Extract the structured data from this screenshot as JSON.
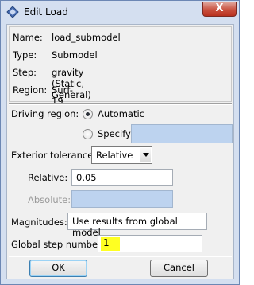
{
  "window": {
    "title": "Edit Load",
    "close_glyph": "X",
    "app_icon": "blue-diamond-icon"
  },
  "info": {
    "name_label": "Name:",
    "name_value": "load_submodel",
    "type_label": "Type:",
    "type_value": "Submodel",
    "step_label": "Step:",
    "step_value": "gravity (Static, General)",
    "region_label": "Region:",
    "region_value": "Surf-19"
  },
  "driving_region": {
    "label": "Driving region:",
    "options": [
      {
        "label": "Automatic",
        "selected": true
      },
      {
        "label": "Specify:",
        "selected": false
      }
    ],
    "specify_value": ""
  },
  "exterior_tolerance": {
    "label": "Exterior tolerance:",
    "selected": "Relative"
  },
  "relative": {
    "label": "Relative:",
    "value": "0.05"
  },
  "absolute": {
    "label": "Absolute:",
    "value": "",
    "enabled": false
  },
  "magnitudes": {
    "label": "Magnitudes:",
    "value": "Use results from global model"
  },
  "global_step": {
    "label": "Global step number:",
    "value": "1",
    "highlight_color": "#ffff22"
  },
  "buttons": {
    "ok": "OK",
    "cancel": "Cancel"
  },
  "colors": {
    "frame": "#d4dff0",
    "client": "#f0f0f0",
    "disabled_field": "#bdd3ef",
    "close_button": "#c9503e"
  }
}
